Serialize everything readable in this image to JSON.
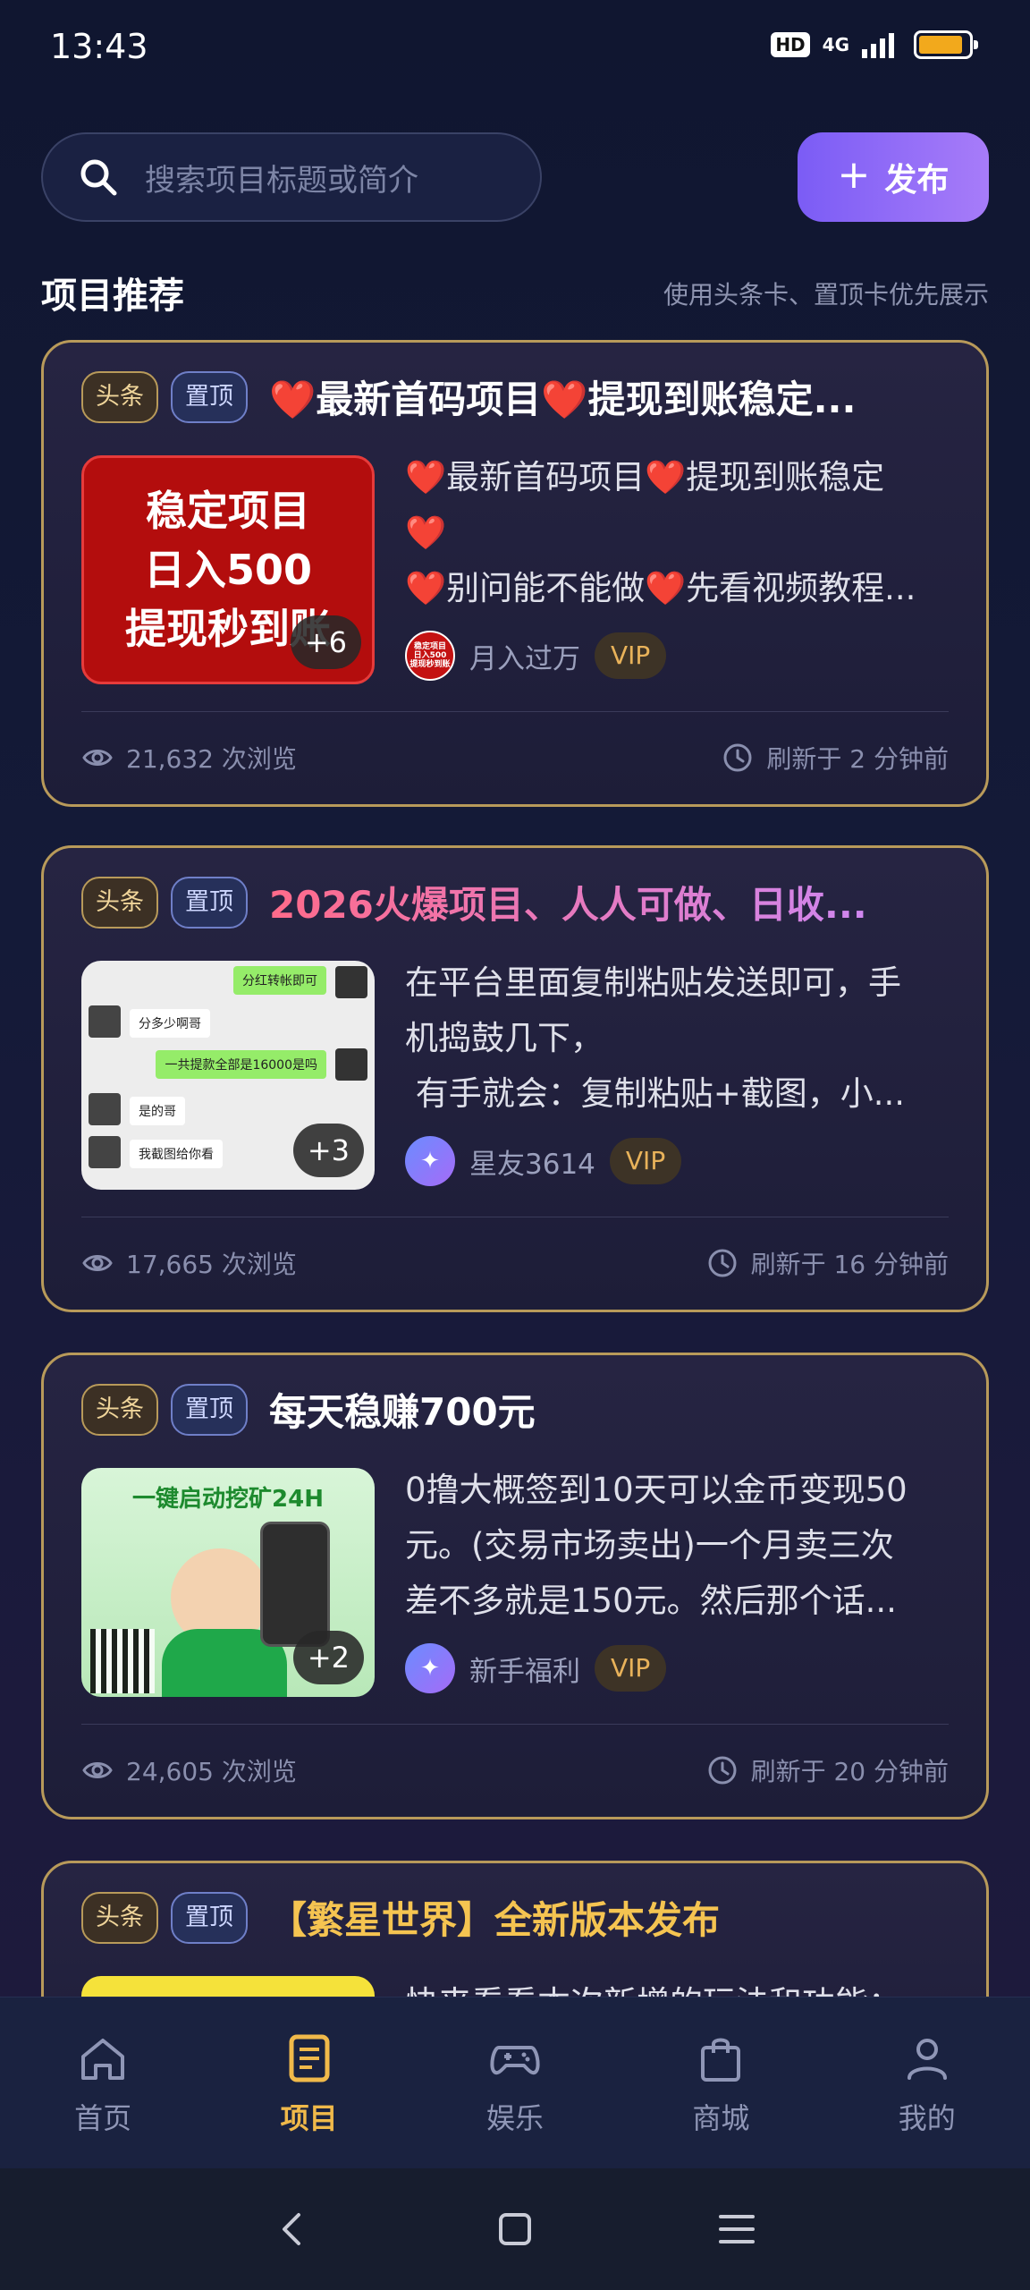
{
  "status": {
    "time": "13:43",
    "hd": "HD",
    "network": "4G"
  },
  "search": {
    "placeholder": "搜索项目标题或简介"
  },
  "publish": {
    "icon": "+",
    "label": "发布"
  },
  "section": {
    "title": "项目推荐",
    "hint": "使用头条卡、置顶卡优先展示"
  },
  "tags": {
    "headline": "头条",
    "pin": "置顶"
  },
  "vip_label": "VIP",
  "cards": [
    {
      "title": "❤️最新首码项目❤️提现到账稳定...",
      "title_color": "#ffffff",
      "thumb_lines": [
        "稳定项目",
        "日入500",
        "提现秒到账"
      ],
      "more": "+6",
      "desc": [
        "❤️最新首码项目❤️提现到账稳定",
        "❤️",
        "❤️别问能不能做❤️先看视频教程..."
      ],
      "author": "月入过万",
      "avatar_text": [
        "稳定项目",
        "日入500",
        "提现秒到账"
      ],
      "views": "21,632 次浏览",
      "refresh": "刷新于 2 分钟前"
    },
    {
      "title": "2026火爆项目、人人可做、日收...",
      "title_color": "#e8a0ff",
      "thumb_chat": [
        "分红转帐即可",
        "分多少啊哥",
        "一共提款全部是16000是吗",
        "是的哥",
        "我截图给你看"
      ],
      "more": "+3",
      "desc": [
        "在平台里面复制粘贴发送即可，手",
        "机捣鼓几下，",
        " 有手就会：复制粘贴+截图，小..."
      ],
      "author": "星友3614",
      "views": "17,665 次浏览",
      "refresh": "刷新于 16 分钟前"
    },
    {
      "title": "每天稳赚700元",
      "title_color": "#ffffff",
      "thumb_banner": "一键启动挖矿24H",
      "more": "+2",
      "desc": [
        "0撸大概签到10天可以金币变现50",
        "元。(交易市场卖出)一个月卖三次",
        "差不多就是150元。然后那个话..."
      ],
      "author": "新手福利",
      "views": "24,605 次浏览",
      "refresh": "刷新于 20 分钟前"
    },
    {
      "title": "【繁星世界】全新版本发布",
      "title_color": "#f5c451",
      "desc": [
        "快来看看本次新增的玩法和功能："
      ]
    }
  ],
  "nav": [
    {
      "label": "首页",
      "icon": "home-icon"
    },
    {
      "label": "项目",
      "icon": "list-icon"
    },
    {
      "label": "娱乐",
      "icon": "gamepad-icon"
    },
    {
      "label": "商城",
      "icon": "shopping-bag-icon"
    },
    {
      "label": "我的",
      "icon": "user-icon"
    }
  ],
  "colors": {
    "accent": "#f0b94a",
    "publish": "#8b6cf7",
    "card_border": "#b89a5a"
  }
}
